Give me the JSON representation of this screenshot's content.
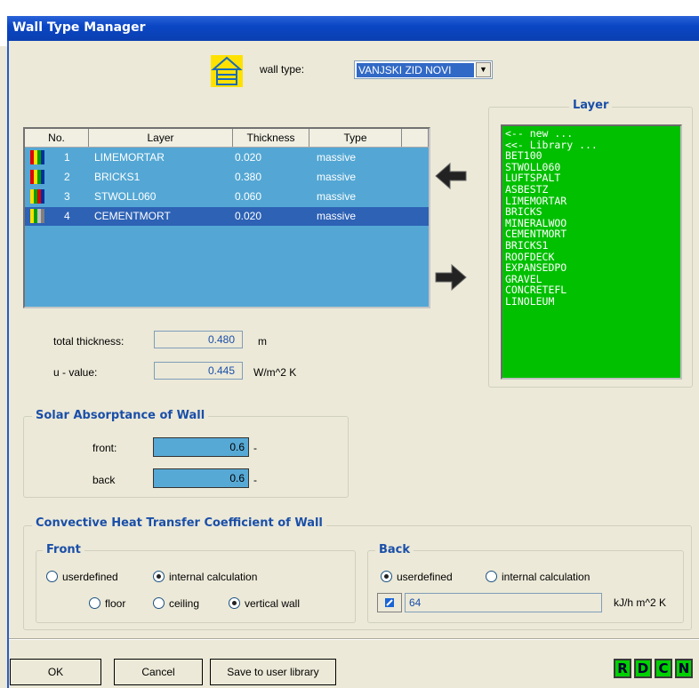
{
  "window": {
    "title": "Wall Type Manager"
  },
  "wall_type": {
    "label": "wall type:",
    "selected": "VANJSKI ZID NOVI"
  },
  "layer_table": {
    "columns": [
      "No.",
      "Layer",
      "Thickness",
      "Type"
    ],
    "rows": [
      {
        "no": "1",
        "layer": "LIMEMORTAR",
        "thickness": "0.020",
        "type": "massive"
      },
      {
        "no": "2",
        "layer": "BRICKS1",
        "thickness": "0.380",
        "type": "massive"
      },
      {
        "no": "3",
        "layer": "STWOLL060",
        "thickness": "0.060",
        "type": "massive"
      },
      {
        "no": "4",
        "layer": "CEMENTMORT",
        "thickness": "0.020",
        "type": "massive"
      }
    ],
    "selected_row": 3
  },
  "layer_panel": {
    "title": "Layer",
    "items": [
      "<-- new ...",
      "<<- Library ...",
      "BET100",
      "STWOLL060",
      "LUFTSPALT",
      "ASBESTZ",
      "LIMEMORTAR",
      "BRICKS",
      "MINERALWOO",
      "CEMENTMORT",
      "BRICKS1",
      "ROOFDECK",
      "EXPANSEDPO",
      "GRAVEL",
      "CONCRETEFL",
      "LINOLEUM"
    ]
  },
  "totals": {
    "total_thickness_label": "total thickness:",
    "total_thickness_value": "0.480",
    "total_thickness_unit": "m",
    "u_value_label": "u - value:",
    "u_value_value": "0.445",
    "u_value_unit": "W/m^2 K"
  },
  "solar": {
    "title": "Solar Absorptance of Wall",
    "front_label": "front:",
    "front_value": "0.6",
    "back_label": "back",
    "back_value": "0.6",
    "unit": "-"
  },
  "convective": {
    "title": "Convective Heat Transfer Coefficient of Wall",
    "front": {
      "title": "Front",
      "userdefined": "userdefined",
      "internal": "internal calculation",
      "floor": "floor",
      "ceiling": "ceiling",
      "vertical": "vertical wall"
    },
    "back": {
      "title": "Back",
      "userdefined": "userdefined",
      "internal": "internal calculation",
      "value": "64",
      "unit": "kJ/h m^2 K"
    }
  },
  "buttons": {
    "ok": "OK",
    "cancel": "Cancel",
    "save": "Save to user library",
    "r": "R",
    "d": "D",
    "c": "C",
    "n": "N"
  },
  "colors": {
    "title_bar": "#0a46c4",
    "grid_bg": "#54a7d4",
    "layer_list_bg": "#00c000",
    "accent_text": "#1a4fa8"
  }
}
